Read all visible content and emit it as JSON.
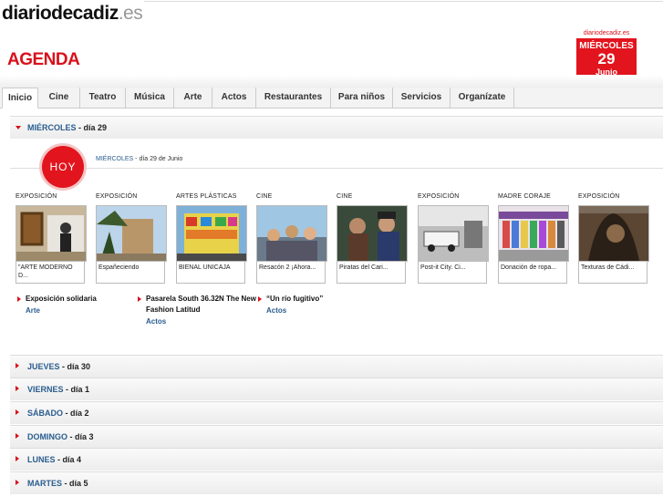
{
  "header": {
    "logo_main": "diariodecadiz",
    "logo_tld": ".es",
    "section_title": "AGENDA"
  },
  "datebox": {
    "site": "diariodecadiz.es",
    "weekday": "MIÉRCOLES",
    "day": "29",
    "month": "Junio"
  },
  "tabs": [
    "Inicio",
    "Cine",
    "Teatro",
    "Música",
    "Arte",
    "Actos",
    "Restaurantes",
    "Para niños",
    "Servicios",
    "Organízate"
  ],
  "open_day": {
    "weekday": "MIÉRCOLES",
    "day_text": " - día 29"
  },
  "hoy": {
    "badge": "HOY",
    "weekday": "MIÉRCOLES",
    "date_text": " - día 29 de Junio"
  },
  "cards": [
    {
      "category": "EXPOSICIÓN",
      "caption": "\"ARTE MODERNO D..."
    },
    {
      "category": "EXPOSICIÓN",
      "caption": "Españeciendo"
    },
    {
      "category": "ARTES PLÁSTICAS",
      "caption": "BIENAL UNICAJA"
    },
    {
      "category": "CINE",
      "caption": "Resacón 2 ¡Ahora..."
    },
    {
      "category": "CINE",
      "caption": "Piratas del Cari..."
    },
    {
      "category": "EXPOSICIÓN",
      "caption": "Post-it City. Ci..."
    },
    {
      "category": "MADRE CORAJE",
      "caption": "Donación de ropa..."
    },
    {
      "category": "EXPOSICIÓN",
      "caption": "Texturas de Cádi..."
    }
  ],
  "featured": [
    {
      "title": "Exposición solidaria",
      "category": "Arte"
    },
    {
      "title": "Pasarela South 36.32N The New Fashion Latitud",
      "category": "Actos"
    },
    {
      "title": "“Un río fugitivo”",
      "category": "Actos"
    }
  ],
  "days": [
    {
      "weekday": "JUEVES",
      "day_text": " - día 30"
    },
    {
      "weekday": "VIERNES",
      "day_text": " - día 1"
    },
    {
      "weekday": "SÁBADO",
      "day_text": " - día 2"
    },
    {
      "weekday": "DOMINGO",
      "day_text": " - día 3"
    },
    {
      "weekday": "LUNES",
      "day_text": " - día 4"
    },
    {
      "weekday": "MARTES",
      "day_text": " - día 5"
    }
  ],
  "colors": {
    "brand_red": "#e2141d",
    "link_blue": "#2a5d8f"
  }
}
